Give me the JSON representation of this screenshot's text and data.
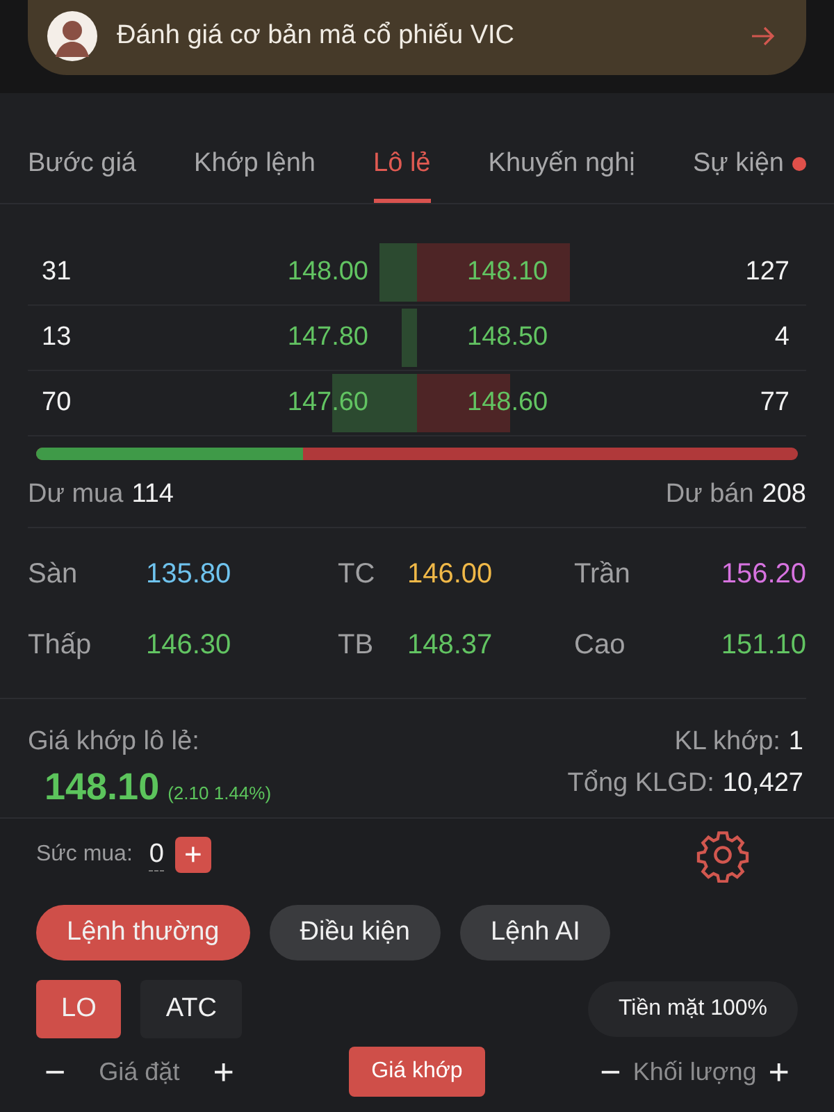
{
  "banner": {
    "text": "Đánh giá cơ bản mã cổ phiếu VIC"
  },
  "tabs": [
    {
      "label": "Bước giá",
      "selected": false,
      "dot": false
    },
    {
      "label": "Khớp lệnh",
      "selected": false,
      "dot": false
    },
    {
      "label": "Lô lẻ",
      "selected": true,
      "dot": false
    },
    {
      "label": "Khuyến nghị",
      "selected": false,
      "dot": false
    },
    {
      "label": "Sự kiện",
      "selected": false,
      "dot": true
    }
  ],
  "order_book": [
    {
      "bid_qty": "31",
      "bid_price": "148.00",
      "ask_price": "148.10",
      "ask_qty": "127"
    },
    {
      "bid_qty": "13",
      "bid_price": "147.80",
      "ask_price": "148.50",
      "ask_qty": "4"
    },
    {
      "bid_qty": "70",
      "bid_price": "147.60",
      "ask_price": "148.60",
      "ask_qty": "77"
    }
  ],
  "balance": {
    "level": 0.35
  },
  "surplus": {
    "buy_label": "Dư mua",
    "buy_value": "114",
    "sell_label": "Dư bán",
    "sell_value": "208"
  },
  "stats": [
    {
      "label": "Sàn",
      "value": "135.80",
      "color": "#6fc3ee"
    },
    {
      "label": "TC",
      "value": "146.00",
      "color": "#f0b848"
    },
    {
      "label": "Trần",
      "value": "156.20",
      "color": "#d773e0"
    },
    {
      "label": "Thấp",
      "value": "146.30",
      "color": "#62c462"
    },
    {
      "label": "TB",
      "value": "148.37",
      "color": "#62c462"
    },
    {
      "label": "Cao",
      "value": "151.10",
      "color": "#62c462"
    }
  ],
  "odd_lot": {
    "title": "Giá khớp lô lẻ:",
    "price": "148.10",
    "change": "(2.10 1.44%)",
    "match_label": "KL khớp:",
    "match_value": "1",
    "total_label": "Tổng KLGD:",
    "total_value": "10,427"
  },
  "order_form": {
    "buying_power_label": "Sức mua:",
    "buying_power_value": "0",
    "add": "+",
    "order_types": [
      {
        "label": "Lệnh thường",
        "selected": true
      },
      {
        "label": "Điều kiện",
        "selected": false
      },
      {
        "label": "Lệnh AI",
        "selected": false
      }
    ],
    "price_types": [
      {
        "label": "LO",
        "selected": true
      },
      {
        "label": "ATC",
        "selected": false
      }
    ],
    "cash": "Tiền mặt 100%",
    "price_field": {
      "minus": "−",
      "placeholder": "Giá đặt",
      "plus": "+"
    },
    "match_price_button": "Giá khớp",
    "volume_field": {
      "minus": "−",
      "placeholder": "Khối lượng",
      "plus": "+"
    }
  }
}
